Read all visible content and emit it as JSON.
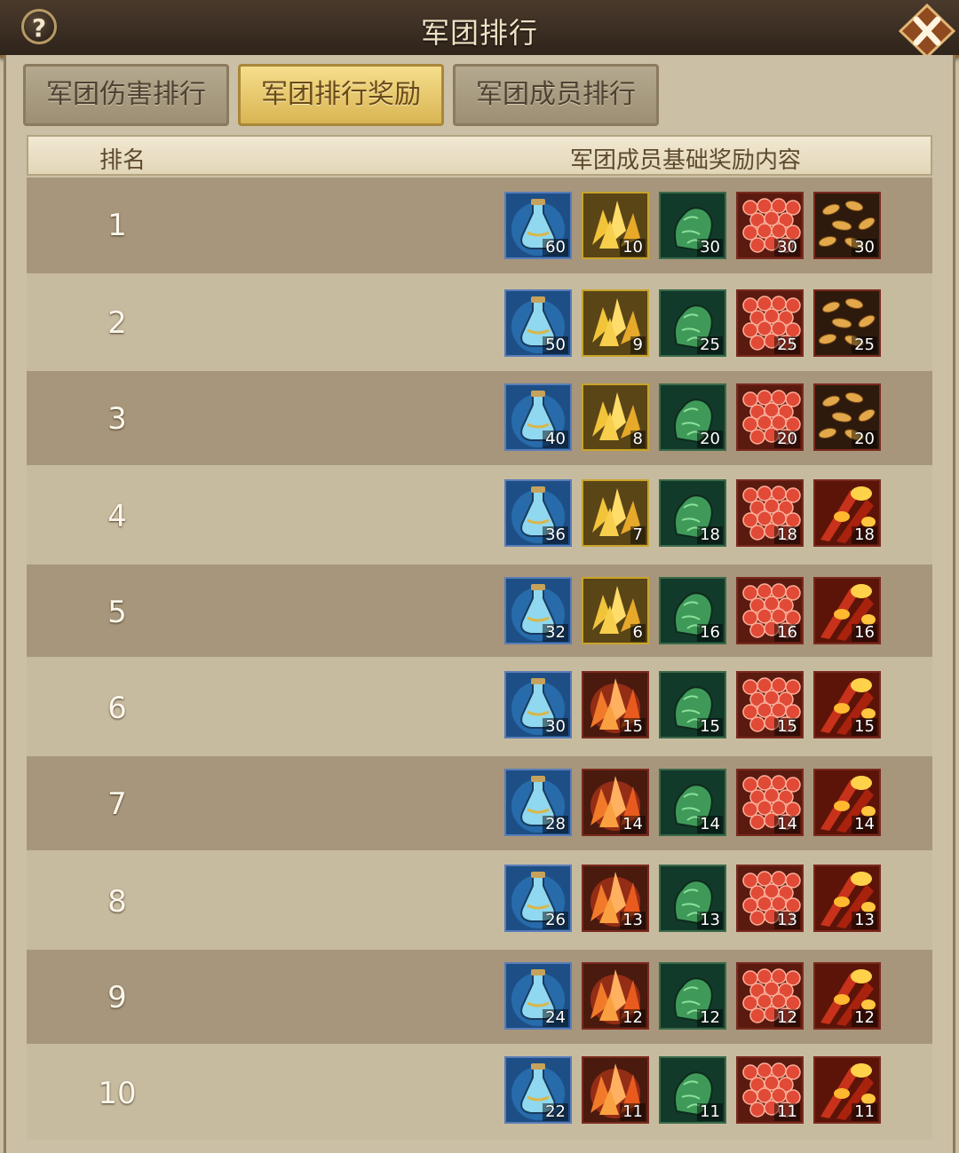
{
  "title": "军团排行",
  "help_label": "?",
  "tabs": [
    {
      "label": "军团伤害排行",
      "active": false
    },
    {
      "label": "军团排行奖励",
      "active": true
    },
    {
      "label": "军团成员排行",
      "active": false
    }
  ],
  "header": {
    "rank": "排名",
    "reward": "军团成员基础奖励内容"
  },
  "rows": [
    {
      "rank": "1",
      "items": [
        {
          "icon": "blue-potion-icon",
          "count": "60"
        },
        {
          "icon": "gold-crystal-icon",
          "count": "10"
        },
        {
          "icon": "green-stone-icon",
          "count": "30"
        },
        {
          "icon": "red-scales-icon",
          "count": "30"
        },
        {
          "icon": "gold-leaves-icon",
          "count": "30"
        }
      ]
    },
    {
      "rank": "2",
      "items": [
        {
          "icon": "blue-potion-icon",
          "count": "50"
        },
        {
          "icon": "gold-crystal-icon",
          "count": "9"
        },
        {
          "icon": "green-stone-icon",
          "count": "25"
        },
        {
          "icon": "red-scales-icon",
          "count": "25"
        },
        {
          "icon": "gold-leaves-icon",
          "count": "25"
        }
      ]
    },
    {
      "rank": "3",
      "items": [
        {
          "icon": "blue-potion-icon",
          "count": "40"
        },
        {
          "icon": "gold-crystal-icon",
          "count": "8"
        },
        {
          "icon": "green-stone-icon",
          "count": "20"
        },
        {
          "icon": "red-scales-icon",
          "count": "20"
        },
        {
          "icon": "gold-leaves-icon",
          "count": "20"
        }
      ]
    },
    {
      "rank": "4",
      "items": [
        {
          "icon": "blue-potion-icon",
          "count": "36"
        },
        {
          "icon": "gold-crystal-icon",
          "count": "7"
        },
        {
          "icon": "green-stone-icon",
          "count": "18"
        },
        {
          "icon": "red-scales-icon",
          "count": "18"
        },
        {
          "icon": "fire-wings-icon",
          "count": "18"
        }
      ]
    },
    {
      "rank": "5",
      "items": [
        {
          "icon": "blue-potion-icon",
          "count": "32"
        },
        {
          "icon": "gold-crystal-icon",
          "count": "6"
        },
        {
          "icon": "green-stone-icon",
          "count": "16"
        },
        {
          "icon": "red-scales-icon",
          "count": "16"
        },
        {
          "icon": "fire-wings-icon",
          "count": "16"
        }
      ]
    },
    {
      "rank": "6",
      "items": [
        {
          "icon": "blue-potion-icon",
          "count": "30"
        },
        {
          "icon": "orange-crystal-icon",
          "count": "15"
        },
        {
          "icon": "green-stone-icon",
          "count": "15"
        },
        {
          "icon": "red-scales-icon",
          "count": "15"
        },
        {
          "icon": "fire-wings-icon",
          "count": "15"
        }
      ]
    },
    {
      "rank": "7",
      "items": [
        {
          "icon": "blue-potion-icon",
          "count": "28"
        },
        {
          "icon": "orange-crystal-icon",
          "count": "14"
        },
        {
          "icon": "green-stone-icon",
          "count": "14"
        },
        {
          "icon": "red-scales-icon",
          "count": "14"
        },
        {
          "icon": "fire-wings-icon",
          "count": "14"
        }
      ]
    },
    {
      "rank": "8",
      "items": [
        {
          "icon": "blue-potion-icon",
          "count": "26"
        },
        {
          "icon": "orange-crystal-icon",
          "count": "13"
        },
        {
          "icon": "green-stone-icon",
          "count": "13"
        },
        {
          "icon": "red-scales-icon",
          "count": "13"
        },
        {
          "icon": "fire-wings-icon",
          "count": "13"
        }
      ]
    },
    {
      "rank": "9",
      "items": [
        {
          "icon": "blue-potion-icon",
          "count": "24"
        },
        {
          "icon": "orange-crystal-icon",
          "count": "12"
        },
        {
          "icon": "green-stone-icon",
          "count": "12"
        },
        {
          "icon": "red-scales-icon",
          "count": "12"
        },
        {
          "icon": "fire-wings-icon",
          "count": "12"
        }
      ]
    },
    {
      "rank": "10",
      "items": [
        {
          "icon": "blue-potion-icon",
          "count": "22"
        },
        {
          "icon": "orange-crystal-icon",
          "count": "11"
        },
        {
          "icon": "green-stone-icon",
          "count": "11"
        },
        {
          "icon": "red-scales-icon",
          "count": "11"
        },
        {
          "icon": "fire-wings-icon",
          "count": "11"
        }
      ]
    }
  ],
  "colors": {
    "active_tab": "#e8c86a",
    "row_dark": "#a7967b",
    "row_light": "#c7bb9f"
  }
}
